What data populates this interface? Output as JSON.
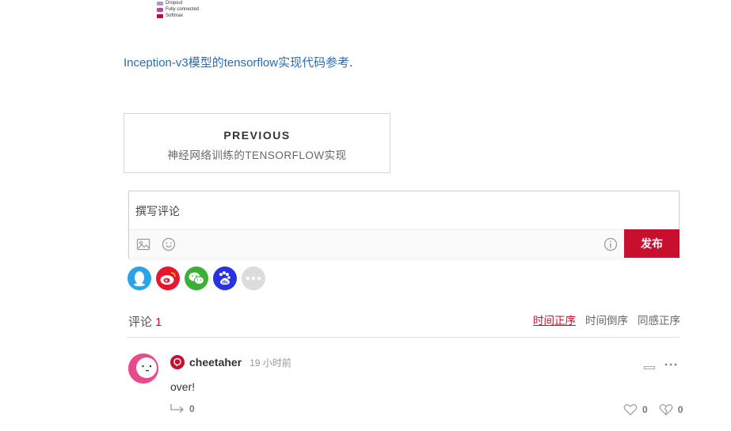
{
  "legend": {
    "items": [
      {
        "label": "Dropout",
        "color": "#a39ad1"
      },
      {
        "label": "Fully connected",
        "color": "#c2449a"
      },
      {
        "label": "Softmax",
        "color": "#b0123a"
      }
    ]
  },
  "reference": {
    "link_text": "Inception-v3模型的tensorflow实现代码参考",
    "trailing": "."
  },
  "previous": {
    "heading": "PREVIOUS",
    "title": "神经网络训练的TENSORFLOW实现"
  },
  "comment_box": {
    "placeholder": "撰写评论",
    "publish_label": "发布",
    "image_icon": "image-icon",
    "emoji_icon": "emoji-icon",
    "info_icon": "info-icon"
  },
  "share": {
    "icons": [
      "qq-icon",
      "weibo-icon",
      "wechat-icon",
      "baidu-icon",
      "more-share-icon"
    ]
  },
  "comments": {
    "label": "评论",
    "count": "1",
    "sort_options": [
      "时间正序",
      "时间倒序",
      "同感正序"
    ],
    "active_sort": "时间正序",
    "items": [
      {
        "username": "cheetaher",
        "time": "19 小时前",
        "text": "over!",
        "replies": "0",
        "likes": "0",
        "dislikes": "0"
      }
    ]
  },
  "colors": {
    "accent": "#c8102e",
    "link": "#2b6cb3"
  }
}
